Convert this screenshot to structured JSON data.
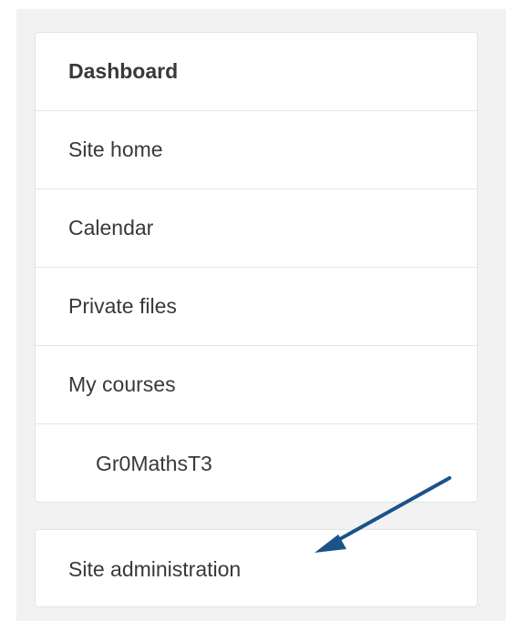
{
  "nav": {
    "items": [
      {
        "label": "Dashboard"
      },
      {
        "label": "Site home"
      },
      {
        "label": "Calendar"
      },
      {
        "label": "Private files"
      },
      {
        "label": "My courses"
      },
      {
        "label": "Gr0MathsT3"
      }
    ]
  },
  "admin": {
    "label": "Site administration"
  },
  "annotation": {
    "arrow_color": "#1a5289"
  }
}
